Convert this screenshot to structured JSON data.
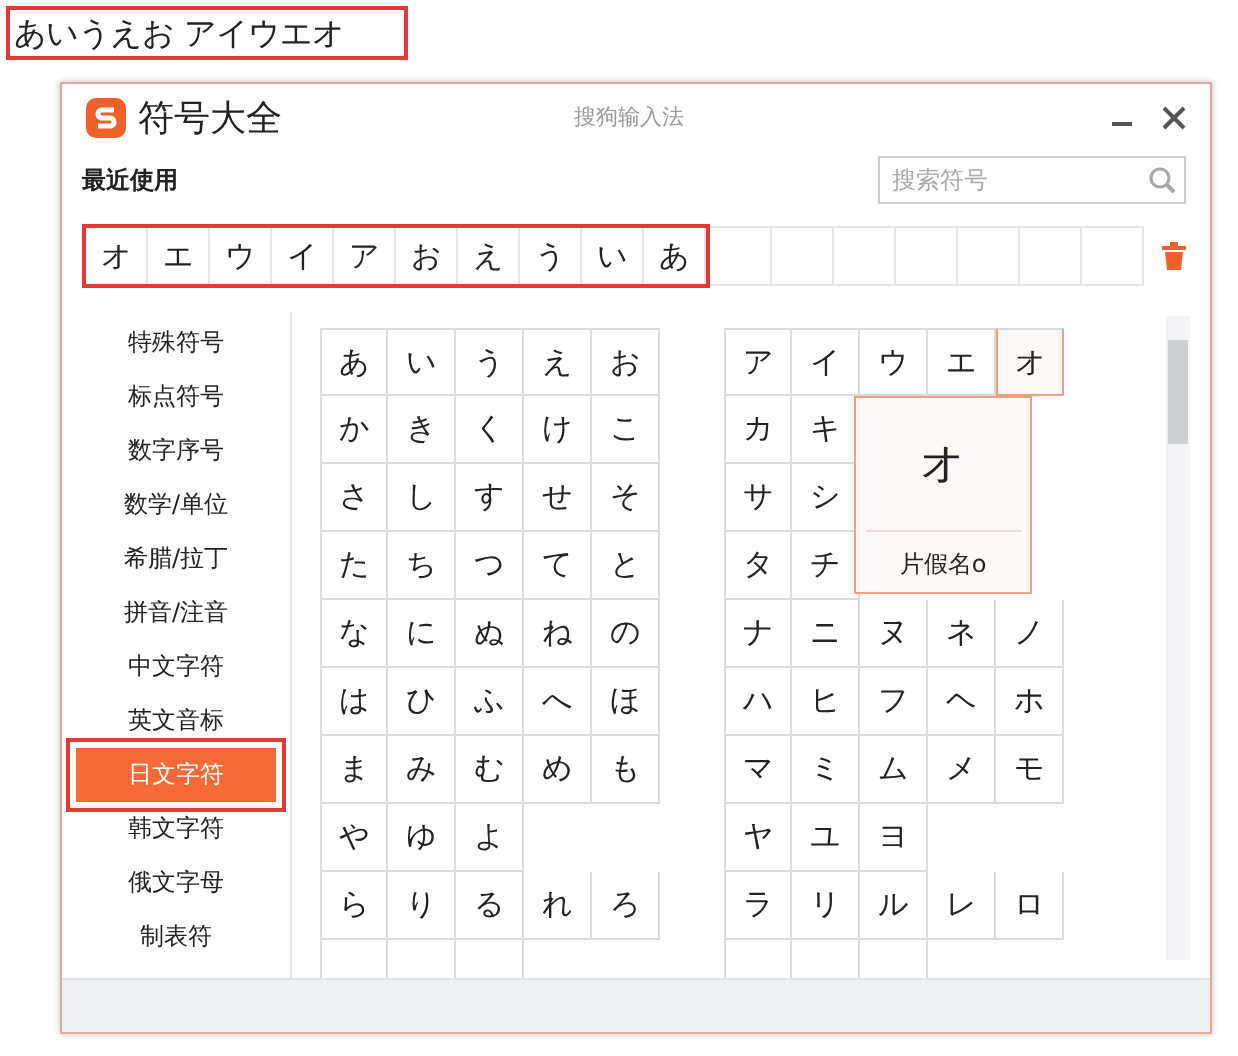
{
  "typed_text": "あいうえお アイウエオ",
  "window": {
    "title": "符号大全",
    "app_name": "搜狗输入法"
  },
  "recent": {
    "label": "最近使用",
    "search": {
      "placeholder": "搜索符号"
    },
    "items": [
      "オ",
      "エ",
      "ウ",
      "イ",
      "ア",
      "お",
      "え",
      "う",
      "い",
      "あ"
    ]
  },
  "categories": [
    {
      "label": "特殊符号",
      "selected": false
    },
    {
      "label": "标点符号",
      "selected": false
    },
    {
      "label": "数字序号",
      "selected": false
    },
    {
      "label": "数学/单位",
      "selected": false
    },
    {
      "label": "希腊/拉丁",
      "selected": false
    },
    {
      "label": "拼音/注音",
      "selected": false
    },
    {
      "label": "中文字符",
      "selected": false
    },
    {
      "label": "英文音标",
      "selected": false
    },
    {
      "label": "日文字符",
      "selected": true
    },
    {
      "label": "韩文字符",
      "selected": false
    },
    {
      "label": "俄文字母",
      "selected": false
    },
    {
      "label": "制表符",
      "selected": false
    }
  ],
  "grids": [
    {
      "rows": [
        [
          {
            "char": "あ",
            "hovered": false
          },
          {
            "char": "い",
            "hovered": false
          },
          {
            "char": "う",
            "hovered": false
          },
          {
            "char": "え",
            "hovered": false
          },
          {
            "char": "お",
            "hovered": false
          }
        ],
        [
          {
            "char": "か",
            "hovered": false
          },
          {
            "char": "き",
            "hovered": false
          },
          {
            "char": "く",
            "hovered": false
          },
          {
            "char": "け",
            "hovered": false
          },
          {
            "char": "こ",
            "hovered": false
          }
        ],
        [
          {
            "char": "さ",
            "hovered": false
          },
          {
            "char": "し",
            "hovered": false
          },
          {
            "char": "す",
            "hovered": false
          },
          {
            "char": "せ",
            "hovered": false
          },
          {
            "char": "そ",
            "hovered": false
          }
        ],
        [
          {
            "char": "た",
            "hovered": false
          },
          {
            "char": "ち",
            "hovered": false
          },
          {
            "char": "つ",
            "hovered": false
          },
          {
            "char": "て",
            "hovered": false
          },
          {
            "char": "と",
            "hovered": false
          }
        ],
        [
          {
            "char": "な",
            "hovered": false
          },
          {
            "char": "に",
            "hovered": false
          },
          {
            "char": "ぬ",
            "hovered": false
          },
          {
            "char": "ね",
            "hovered": false
          },
          {
            "char": "の",
            "hovered": false
          }
        ],
        [
          {
            "char": "は",
            "hovered": false
          },
          {
            "char": "ひ",
            "hovered": false
          },
          {
            "char": "ふ",
            "hovered": false
          },
          {
            "char": "へ",
            "hovered": false
          },
          {
            "char": "ほ",
            "hovered": false
          }
        ],
        [
          {
            "char": "ま",
            "hovered": false
          },
          {
            "char": "み",
            "hovered": false
          },
          {
            "char": "む",
            "hovered": false
          },
          {
            "char": "め",
            "hovered": false
          },
          {
            "char": "も",
            "hovered": false
          }
        ],
        [
          {
            "char": "や",
            "hovered": false
          },
          {
            "char": "ゆ",
            "hovered": false
          },
          {
            "char": "よ",
            "hovered": false
          },
          null,
          null
        ],
        [
          {
            "char": "ら",
            "hovered": false
          },
          {
            "char": "り",
            "hovered": false
          },
          {
            "char": "る",
            "hovered": false
          },
          {
            "char": "れ",
            "hovered": false
          },
          {
            "char": "ろ",
            "hovered": false
          }
        ]
      ]
    },
    {
      "rows": [
        [
          {
            "char": "ア",
            "hovered": false
          },
          {
            "char": "イ",
            "hovered": false
          },
          {
            "char": "ウ",
            "hovered": false
          },
          {
            "char": "エ",
            "hovered": false
          },
          {
            "char": "オ",
            "hovered": true
          }
        ],
        [
          {
            "char": "カ",
            "hovered": false
          },
          {
            "char": "キ",
            "hovered": false
          },
          null,
          null,
          null
        ],
        [
          {
            "char": "サ",
            "hovered": false
          },
          {
            "char": "シ",
            "hovered": false
          },
          null,
          null,
          null
        ],
        [
          {
            "char": "タ",
            "hovered": false
          },
          {
            "char": "チ",
            "hovered": false
          },
          null,
          null,
          null
        ],
        [
          {
            "char": "ナ",
            "hovered": false
          },
          {
            "char": "ニ",
            "hovered": false
          },
          {
            "char": "ヌ",
            "hovered": false
          },
          {
            "char": "ネ",
            "hovered": false
          },
          {
            "char": "ノ",
            "hovered": false
          }
        ],
        [
          {
            "char": "ハ",
            "hovered": false
          },
          {
            "char": "ヒ",
            "hovered": false
          },
          {
            "char": "フ",
            "hovered": false
          },
          {
            "char": "ヘ",
            "hovered": false
          },
          {
            "char": "ホ",
            "hovered": false
          }
        ],
        [
          {
            "char": "マ",
            "hovered": false
          },
          {
            "char": "ミ",
            "hovered": false
          },
          {
            "char": "ム",
            "hovered": false
          },
          {
            "char": "メ",
            "hovered": false
          },
          {
            "char": "モ",
            "hovered": false
          }
        ],
        [
          {
            "char": "ヤ",
            "hovered": false
          },
          {
            "char": "ユ",
            "hovered": false
          },
          {
            "char": "ヨ",
            "hovered": false
          },
          null,
          null
        ],
        [
          {
            "char": "ラ",
            "hovered": false
          },
          {
            "char": "リ",
            "hovered": false
          },
          {
            "char": "ル",
            "hovered": false
          },
          {
            "char": "レ",
            "hovered": false
          },
          {
            "char": "ロ",
            "hovered": false
          }
        ]
      ],
      "popup": {
        "char": "オ",
        "label": "片假名o"
      }
    }
  ]
}
